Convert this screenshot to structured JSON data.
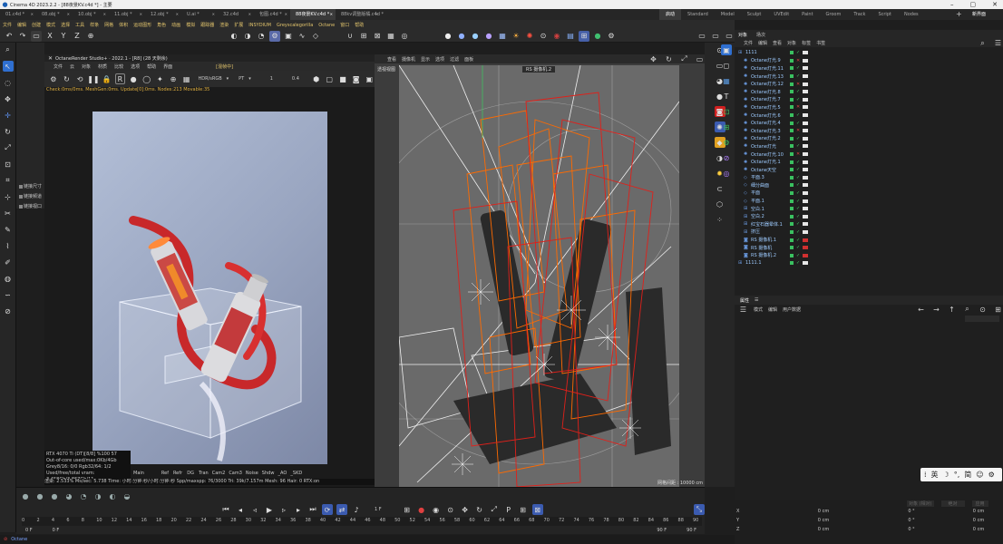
{
  "window": {
    "title": "Cinema 4D 2023.2.2 - [88夜景KV.c4d *] - 主要"
  },
  "file_tabs": [
    "01.c4d *",
    "08.obj *",
    "10.obj *",
    "11.obj *",
    "12.obj *",
    "U.ai *",
    "32.c4d",
    "包图.c4d *",
    "88夜景KV.c4d *",
    "88kv调整版橘.c4d *"
  ],
  "active_file_tab": 8,
  "layout_tabs": [
    "启动",
    "Standard",
    "Model",
    "Sculpt",
    "UVEdit",
    "Paint",
    "Groom",
    "Track",
    "Script",
    "Nodes"
  ],
  "new_layout_label": "新界面",
  "menu": [
    "文件",
    "编辑",
    "创建",
    "模式",
    "选择",
    "工具",
    "样条",
    "网格",
    "体积",
    "运动图形",
    "角色",
    "动画",
    "模拟",
    "跟踪器",
    "渲染",
    "扩展",
    "INSYDIUM",
    "Greyscalegorilla",
    "Octane",
    "窗口",
    "帮助"
  ],
  "toolbar": {
    "axes": [
      "X",
      "Y",
      "Z"
    ]
  },
  "octane": {
    "title": "OctaneRender Studio+ · 2022.1 - [R8] (28 天剩余)",
    "menu": [
      "文件",
      "云",
      "对象",
      "材质",
      "比较",
      "选项",
      "帮助",
      "界面"
    ],
    "menu_tag": "[混帧中]",
    "color_mode": "HDR/sRGB",
    "mode": "PT",
    "value_a": "1",
    "value_b": "0.4",
    "status": "Check:0ms/0ms. MeshGen:0ms. Update[0]:0ms. Nodes:213 Movable:35",
    "info_lines": [
      "RTX 4070 Ti (DT)[8/8]   %100   57",
      "Out-of-core used/max:0Kb/4Gb",
      "Grey8/16: 0/0          Rgb32/64: 1/2",
      "Used/free/total vram: 3.458Gb/3.867Gb/11"
    ],
    "bottom": "渲染: 2.533%   Ms/sec: 5.738   Time: 小时:分钟:秒/小时:分钟:秒   Spp/maxspp: 76/3000   Tri: 39k/7.157m   Mesh: 96   Hair: 0   RTX:on",
    "passes": [
      "Main",
      "",
      "Ref",
      "Refr",
      "DG",
      "Tran",
      "Cam2",
      "Cam3",
      "Noise",
      "Shdw",
      "_AO",
      "_SKD"
    ]
  },
  "viewport": {
    "menu": [
      "查看",
      "摄像机",
      "显示",
      "选项",
      "过滤",
      "面板"
    ],
    "name": "透视视图",
    "camera": "RS 摄像机.2",
    "grid_label": "网格间距 : 10000 cm"
  },
  "left_panel": [
    "链接尺寸",
    "链接频道",
    "链接视口"
  ],
  "objects": {
    "tabs": [
      "对象",
      "场次"
    ],
    "menu": [
      "文件",
      "编辑",
      "查看",
      "对象",
      "标签",
      "书签"
    ],
    "items": [
      {
        "name": "1111",
        "indent": 0
      },
      {
        "name": "Octane灯光.9",
        "indent": 1
      },
      {
        "name": "Octane灯光.11",
        "indent": 1
      },
      {
        "name": "Octane灯光.13",
        "indent": 1
      },
      {
        "name": "Octane灯光.12",
        "indent": 1
      },
      {
        "name": "Octane灯光.8",
        "indent": 1
      },
      {
        "name": "Octane灯光.7",
        "indent": 1
      },
      {
        "name": "Octane灯光.5",
        "indent": 1
      },
      {
        "name": "Octane灯光.6",
        "indent": 1
      },
      {
        "name": "Octane灯光.4",
        "indent": 1
      },
      {
        "name": "Octane灯光.3",
        "indent": 1
      },
      {
        "name": "Octane灯光.2",
        "indent": 1
      },
      {
        "name": "Octane灯光",
        "indent": 1
      },
      {
        "name": "Octane灯光.10",
        "indent": 1
      },
      {
        "name": "Octane灯光.1",
        "indent": 1
      },
      {
        "name": "Octane天空",
        "indent": 1
      },
      {
        "name": "平面.3",
        "indent": 1
      },
      {
        "name": "细分曲面",
        "indent": 1
      },
      {
        "name": "平面",
        "indent": 1
      },
      {
        "name": "平面.1",
        "indent": 1
      },
      {
        "name": "空白.1",
        "indent": 1
      },
      {
        "name": "空白.2",
        "indent": 1
      },
      {
        "name": "红宝石器晕体.1",
        "indent": 1
      },
      {
        "name": "挤压",
        "indent": 1
      },
      {
        "name": "RS 摄像机.1",
        "indent": 1
      },
      {
        "name": "RS 摄像机",
        "indent": 1
      },
      {
        "name": "RS 摄像机.2",
        "indent": 1
      },
      {
        "name": "1111.1",
        "indent": 0
      }
    ]
  },
  "attributes": {
    "tab": "属性",
    "menu": [
      "模式",
      "编辑",
      "用户数据"
    ]
  },
  "coordinates": {
    "labels": [
      "X",
      "Y",
      "Z"
    ],
    "col1": [
      "0 cm",
      "0 cm",
      "0 cm"
    ],
    "col2": [
      "0 °",
      "0 °",
      "0 °"
    ],
    "col3": [
      "0 cm",
      "0 cm",
      "0 cm"
    ],
    "headers": [
      "对象 (相对)",
      "绝对",
      "应用"
    ]
  },
  "timeline": {
    "ticks": [
      "0",
      "2",
      "4",
      "6",
      "8",
      "10",
      "12",
      "14",
      "16",
      "18",
      "20",
      "22",
      "24",
      "26",
      "28",
      "30",
      "32",
      "34",
      "36",
      "38",
      "40",
      "42",
      "44",
      "46",
      "48",
      "50",
      "52",
      "54",
      "56",
      "58",
      "60",
      "62",
      "64",
      "66",
      "68",
      "70",
      "72",
      "74",
      "76",
      "78",
      "80",
      "82",
      "84",
      "86",
      "88",
      "90"
    ],
    "start": "0 F",
    "start2": "0 F",
    "end": "90 F",
    "end2": "90 F",
    "current": "1 F"
  },
  "status": {
    "text": "Octane"
  },
  "ime": {
    "items": [
      "英",
      "简"
    ]
  },
  "colors": {
    "accent": "#e2c46c",
    "link": "#9ecbff",
    "render_bg": "#9aa6c1"
  }
}
